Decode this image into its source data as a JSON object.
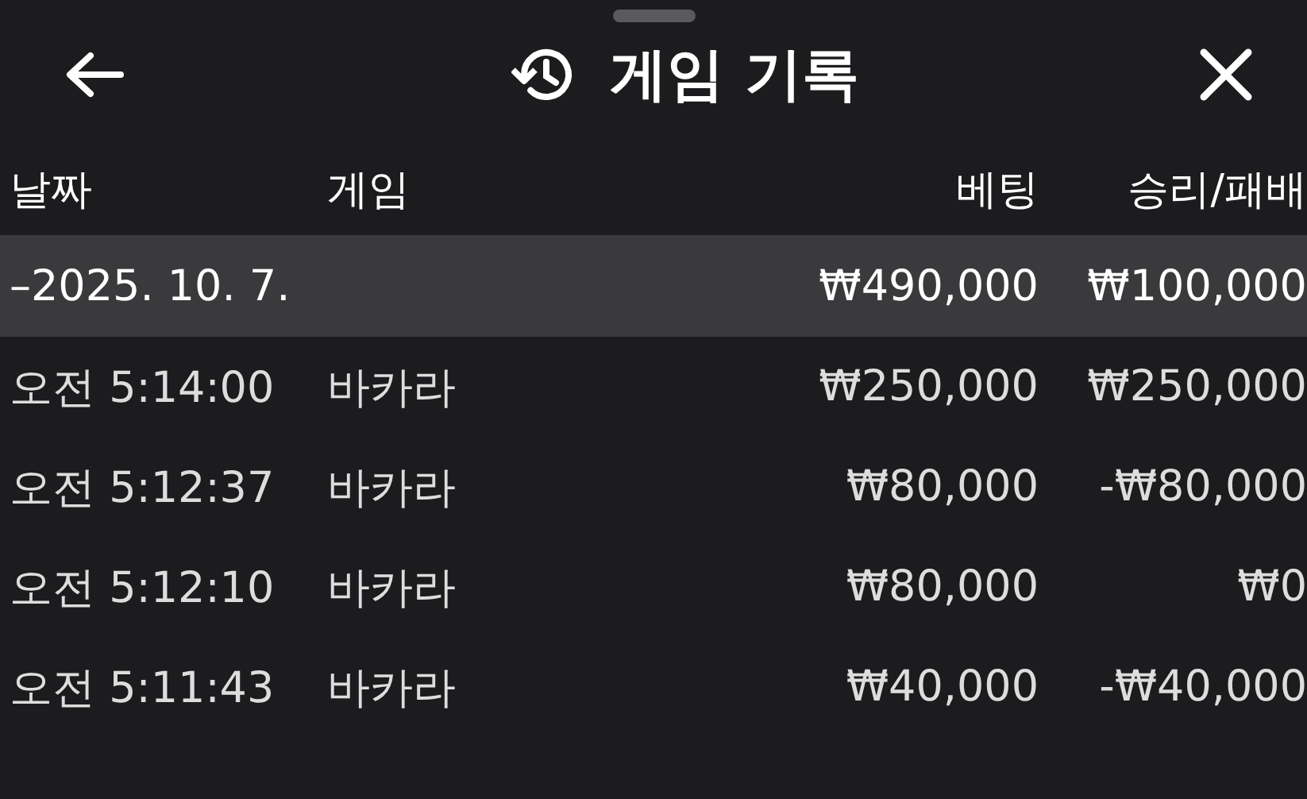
{
  "header": {
    "title": "게임 기록"
  },
  "table": {
    "columns": [
      "날짜",
      "게임",
      "베팅",
      "승리/패배"
    ],
    "group": {
      "date": "–2025. 10. 7.",
      "bet": "₩490,000",
      "result": "₩100,000"
    },
    "rows": [
      {
        "time": "오전 5:14:00",
        "game": "바카라",
        "bet": "₩250,000",
        "result": "₩250,000"
      },
      {
        "time": "오전 5:12:37",
        "game": "바카라",
        "bet": "₩80,000",
        "result": "-₩80,000"
      },
      {
        "time": "오전 5:12:10",
        "game": "바카라",
        "bet": "₩80,000",
        "result": "₩0"
      },
      {
        "time": "오전 5:11:43",
        "game": "바카라",
        "bet": "₩40,000",
        "result": "-₩40,000"
      }
    ]
  }
}
